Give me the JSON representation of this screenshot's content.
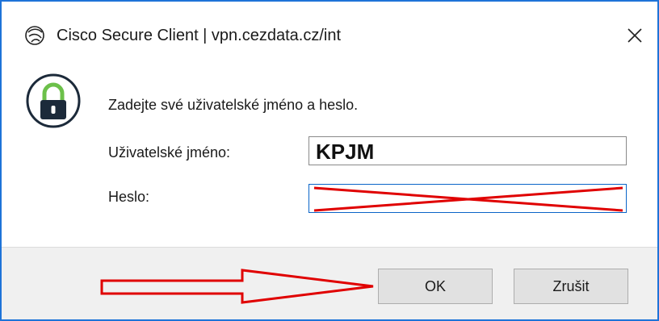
{
  "window": {
    "title": "Cisco Secure Client | vpn.cezdata.cz/int",
    "accent": "#1e73d8"
  },
  "icons": {
    "app": "globe-icon",
    "close": "close-icon",
    "lock": "lock-icon"
  },
  "form": {
    "prompt": "Zadejte své uživatelské jméno a heslo.",
    "username_label": "Uživatelské jméno:",
    "username_value": "KPJM",
    "password_label": "Heslo:"
  },
  "buttons": {
    "ok": "OK",
    "cancel": "Zrušit"
  },
  "annotations": {
    "color": "#e00000"
  }
}
